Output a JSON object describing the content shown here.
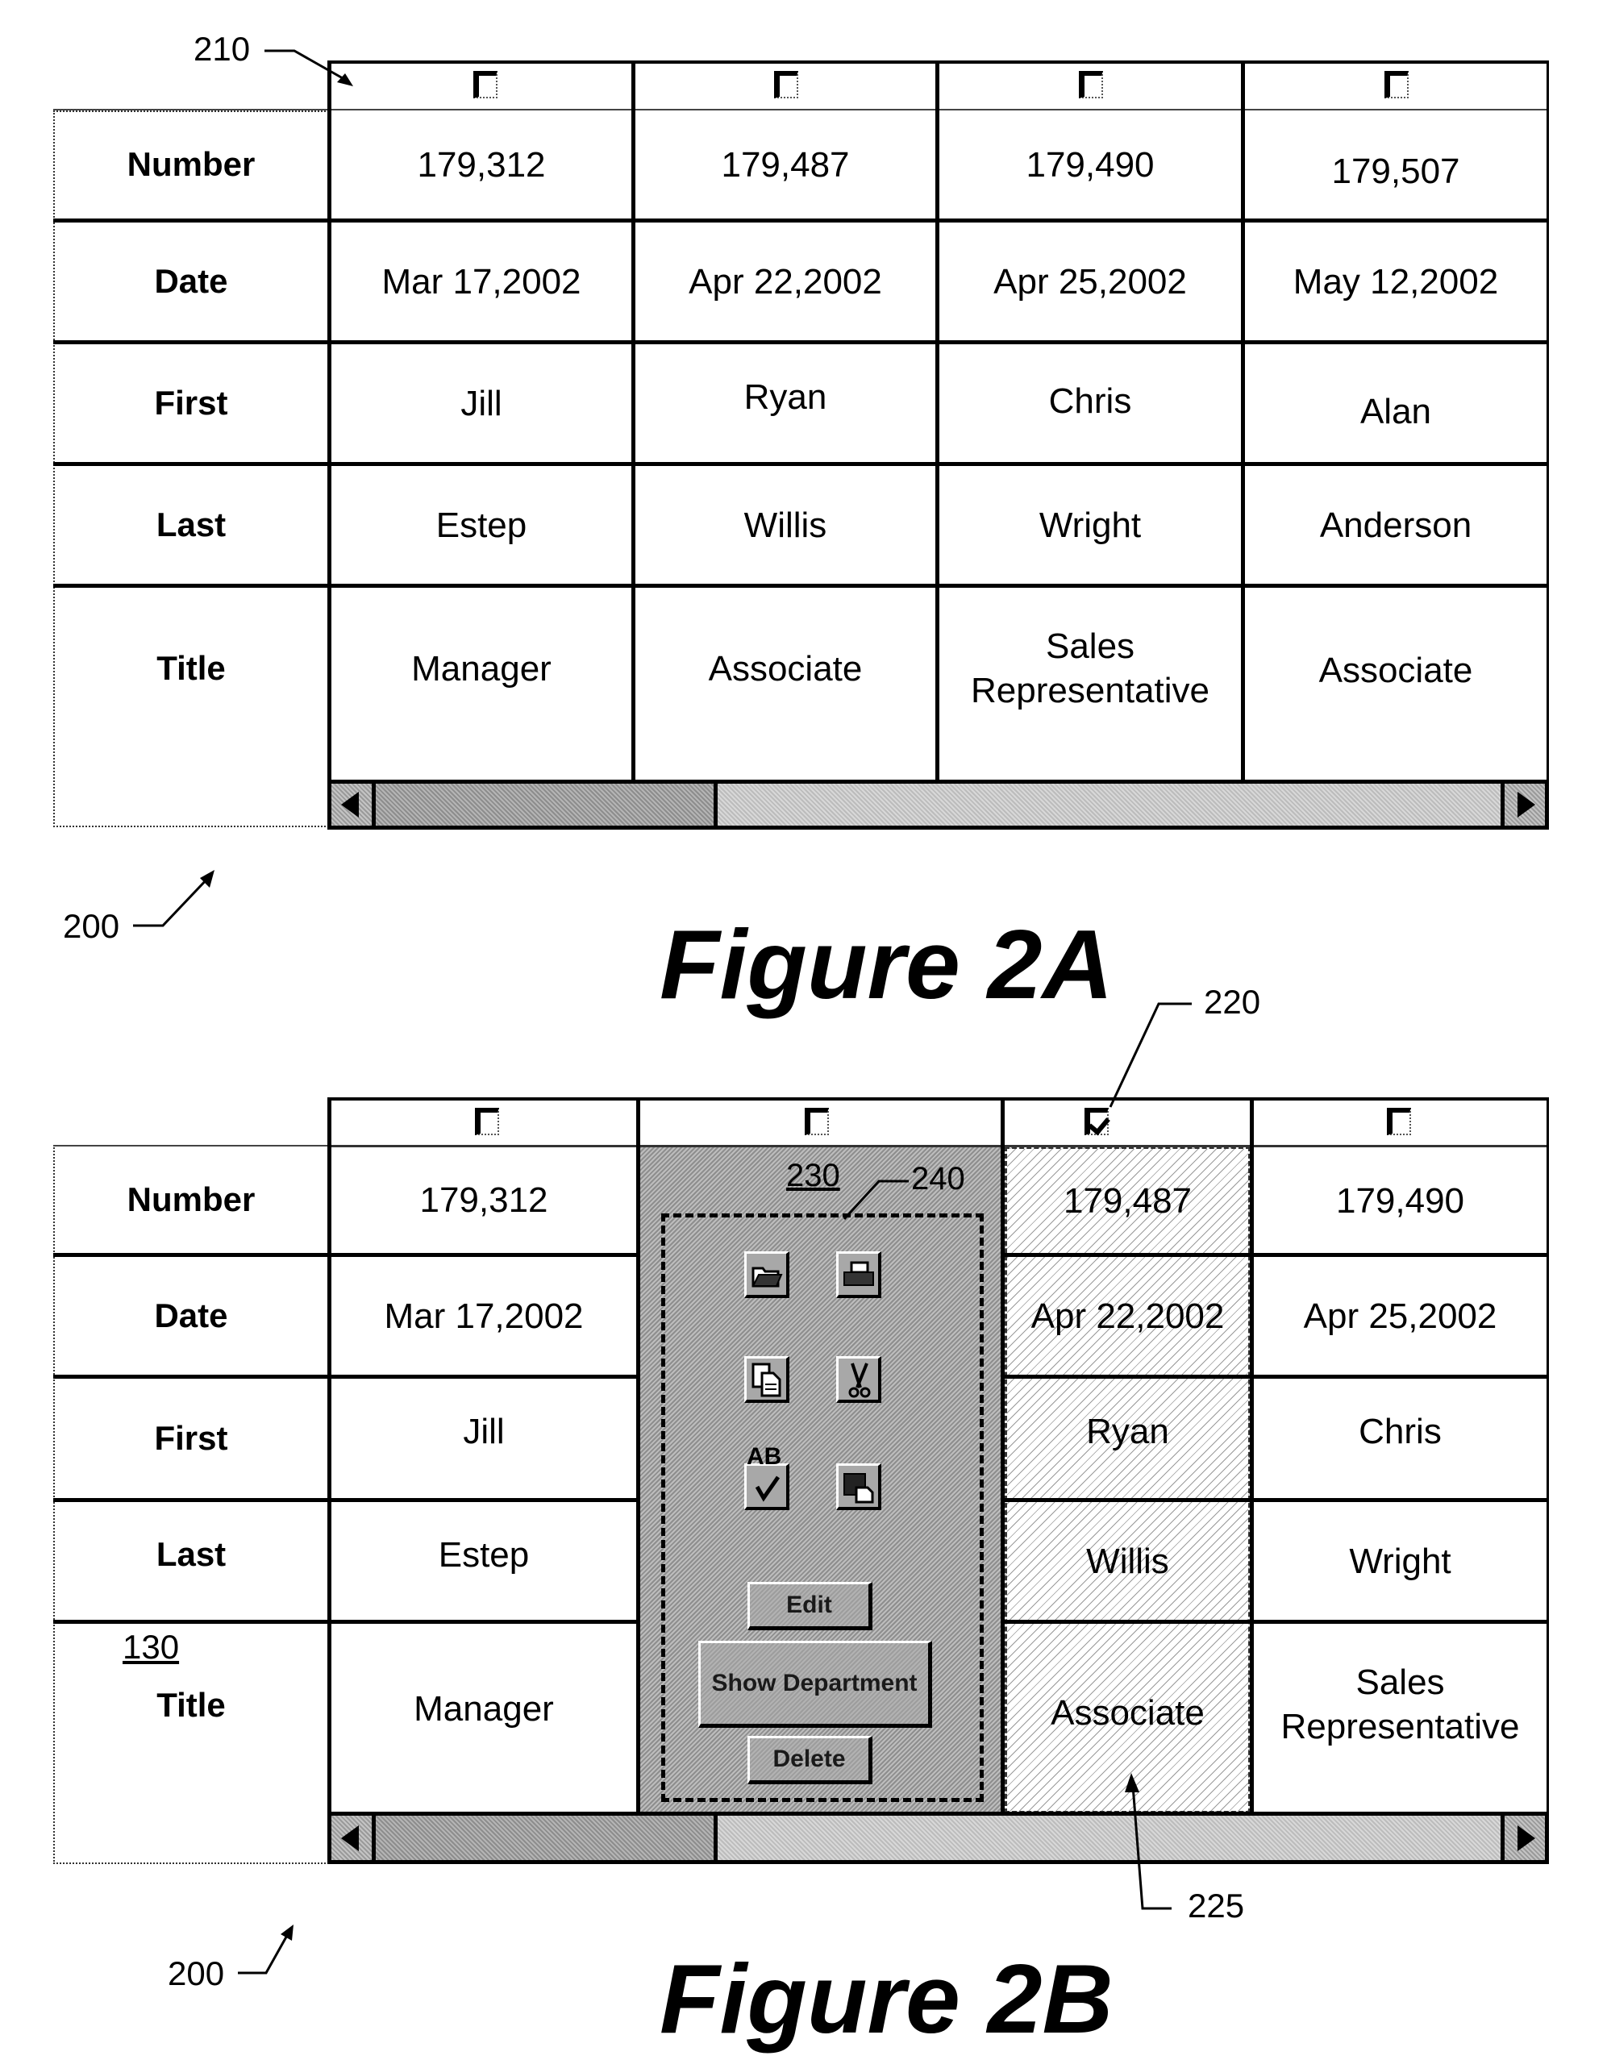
{
  "figure_a": {
    "caption": "Figure 2A",
    "ref_table": "200",
    "ref_header": "210",
    "row_labels": [
      "Number",
      "Date",
      "First",
      "Last",
      "Title"
    ],
    "columns": [
      {
        "checked": false,
        "number": "179,312",
        "date": "Mar 17,2002",
        "first": "Jill",
        "last": "Estep",
        "title": "Manager"
      },
      {
        "checked": false,
        "number": "179,487",
        "date": "Apr 22,2002",
        "first": "Ryan",
        "last": "Willis",
        "title": "Associate"
      },
      {
        "checked": false,
        "number": "179,490",
        "date": "Apr 25,2002",
        "first": "Chris",
        "last": "Wright",
        "title": "Sales Representative"
      },
      {
        "checked": false,
        "number": "179,507",
        "date": "May 12,2002",
        "first": "Alan",
        "last": "Anderson",
        "title": "Associate"
      }
    ],
    "scrollbar": {
      "position_fraction": 0.0,
      "left_icon": "arrow-left",
      "right_icon": "arrow-right"
    }
  },
  "figure_b": {
    "caption": "Figure 2B",
    "ref_table": "200",
    "ref_checkbox": "220",
    "ref_selected_column": "225",
    "ref_popup": "230",
    "ref_popup_border": "240",
    "ref_label_column": "130",
    "row_labels": [
      "Number",
      "Date",
      "First",
      "Last",
      "Title"
    ],
    "columns": [
      {
        "checked": false,
        "number": "179,312",
        "date": "Mar 17,2002",
        "first": "Jill",
        "last": "Estep",
        "title": "Manager"
      },
      {
        "checked": false,
        "popup": true
      },
      {
        "checked": true,
        "selected": true,
        "number": "179,487",
        "date": "Apr 22,2002",
        "first": "Ryan",
        "last": "Willis",
        "title": "Associate"
      },
      {
        "checked": false,
        "number": "179,490",
        "date": "Apr 25,2002",
        "first": "Chris",
        "last": "Wright",
        "title": "Sales Representative"
      }
    ],
    "popup": {
      "tools": [
        "open-folder",
        "print",
        "copy",
        "cut",
        "spell-check",
        "paste"
      ],
      "spell_label": "AB",
      "buttons": {
        "edit": "Edit",
        "show_department": "Show Department",
        "delete": "Delete"
      }
    },
    "scrollbar": {
      "position_fraction": 0.0,
      "left_icon": "arrow-left",
      "right_icon": "arrow-right"
    }
  }
}
